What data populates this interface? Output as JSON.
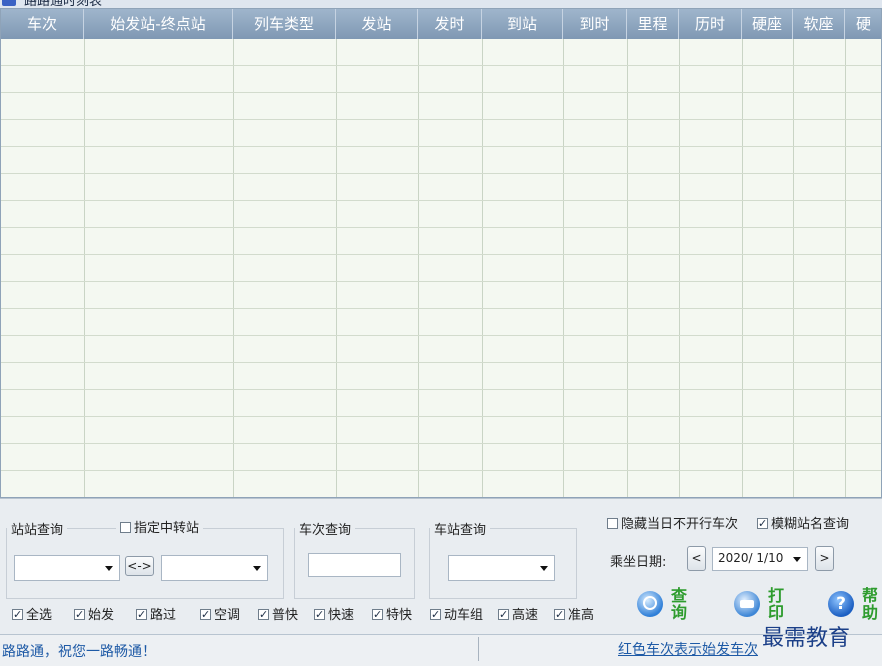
{
  "titlebar": {
    "title": "路路通时刻表"
  },
  "table": {
    "columns": [
      "车次",
      "始发站-终点站",
      "列车类型",
      "发站",
      "发时",
      "到站",
      "到时",
      "里程",
      "历时",
      "硬座",
      "软座",
      "硬"
    ],
    "rows": []
  },
  "station_query": {
    "legend": "站站查询",
    "transfer_label": "指定中转站",
    "transfer_checked": false,
    "from_value": "",
    "to_value": "",
    "swap_label": "<->"
  },
  "train_query": {
    "legend": "车次查询",
    "value": ""
  },
  "station_lookup": {
    "legend": "车站查询",
    "value": ""
  },
  "options": {
    "hide_not_running": {
      "label": "隐藏当日不开行车次",
      "checked": false
    },
    "fuzzy_name": {
      "label": "模糊站名查询",
      "checked": true
    }
  },
  "date": {
    "label": "乘坐日期:",
    "value": "2020/ 1/10",
    "prev": "<",
    "next": ">"
  },
  "filters": [
    {
      "label": "全选",
      "checked": true
    },
    {
      "label": "始发",
      "checked": true
    },
    {
      "label": "路过",
      "checked": true
    },
    {
      "label": "空调",
      "checked": true
    },
    {
      "label": "普快",
      "checked": true
    },
    {
      "label": "快速",
      "checked": true
    },
    {
      "label": "特快",
      "checked": true
    },
    {
      "label": "动车组",
      "checked": true
    },
    {
      "label": "高速",
      "checked": true
    },
    {
      "label": "准高",
      "checked": true
    }
  ],
  "actions": {
    "query": {
      "label": "查询",
      "icon": "magnifier-icon"
    },
    "print": {
      "label": "打印",
      "icon": "printer-icon"
    },
    "help": {
      "label": "帮助",
      "icon": "help-icon"
    }
  },
  "status": {
    "left": "路路通，祝您一路畅通！",
    "right": "红色车次表示始发车次"
  },
  "watermark": "最需教育"
}
